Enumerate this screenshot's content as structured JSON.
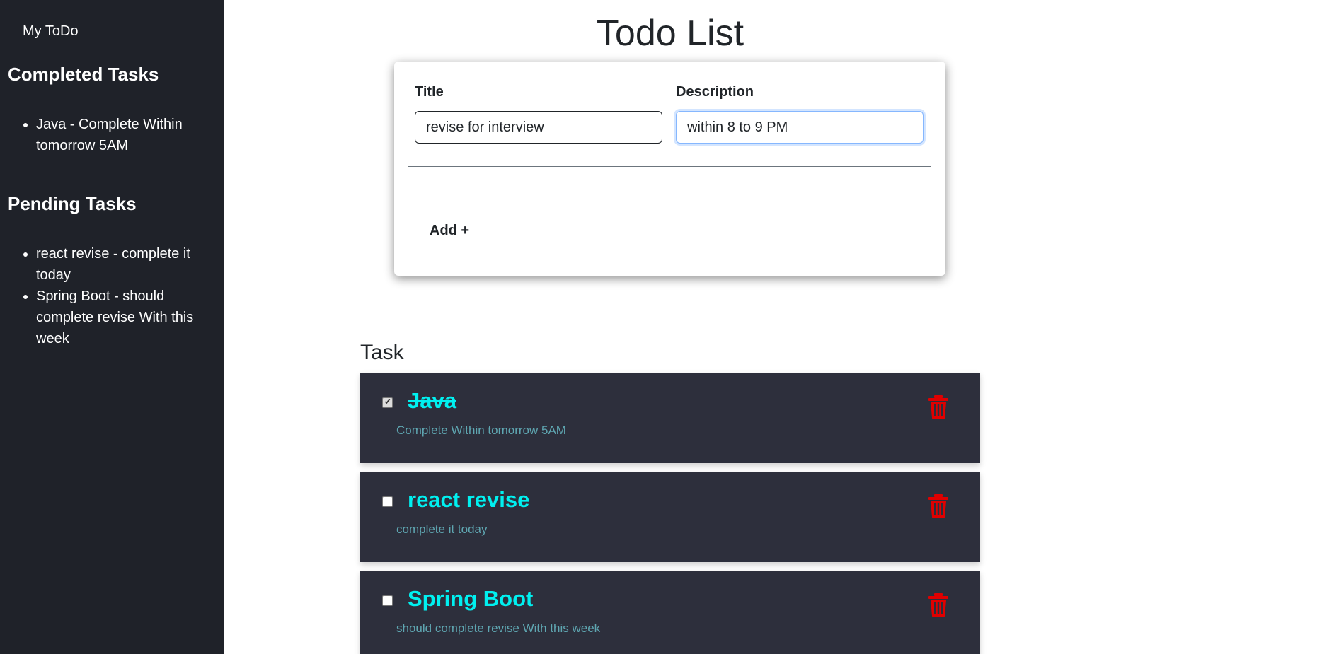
{
  "sidebar": {
    "brand": "My ToDo",
    "completed_heading": "Completed Tasks",
    "completed_items": [
      "Java - Complete Within tomorrow 5AM"
    ],
    "pending_heading": "Pending Tasks",
    "pending_items": [
      "react revise - complete it today",
      "Spring Boot - should complete revise With this week"
    ]
  },
  "main": {
    "title": "Todo List",
    "form": {
      "title_label": "Title",
      "title_value": "revise for interview",
      "description_label": "Description",
      "description_value": "within 8 to 9 PM",
      "add_label": "Add +"
    },
    "tasks_heading": "Task",
    "tasks": [
      {
        "title": "Java",
        "description": "Complete Within tomorrow 5AM",
        "completed": true
      },
      {
        "title": "react revise",
        "description": "complete it today",
        "completed": false
      },
      {
        "title": "Spring Boot",
        "description": "should complete revise With this week",
        "completed": false
      }
    ]
  },
  "colors": {
    "sidebar_bg": "#1f2229",
    "task_bg": "#2d2f3c",
    "task_title": "#00f0f0",
    "task_desc": "#5fa7b2",
    "delete_icon": "#e00000"
  },
  "icons": {
    "delete": "trash-icon",
    "check": "checkbox-icon"
  }
}
